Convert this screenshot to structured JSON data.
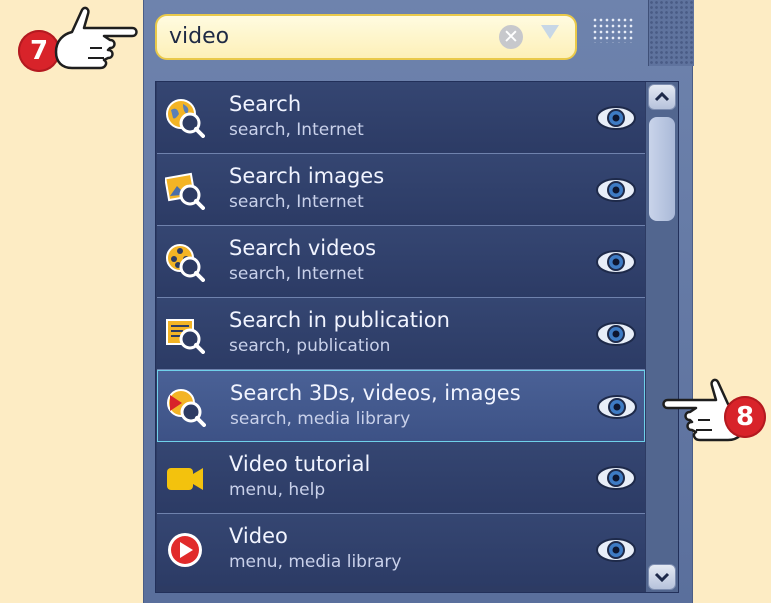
{
  "search": {
    "value": "video"
  },
  "callouts": [
    "7",
    "8"
  ],
  "results": [
    {
      "title": "Search",
      "tags": "search, Internet",
      "icon": "globe-search-icon"
    },
    {
      "title": "Search images",
      "tags": "search, Internet",
      "icon": "image-search-icon"
    },
    {
      "title": "Search videos",
      "tags": "search, Internet",
      "icon": "film-reel-search-icon"
    },
    {
      "title": "Search in publication",
      "tags": "search, publication",
      "icon": "publication-search-icon"
    },
    {
      "title": "Search 3Ds, videos, images",
      "tags": "search, media library",
      "icon": "media-search-icon"
    },
    {
      "title": "Video tutorial",
      "tags": "menu, help",
      "icon": "video-camera-icon"
    },
    {
      "title": "Video",
      "tags": "menu, media library",
      "icon": "play-circle-icon"
    }
  ],
  "colors": {
    "background": "#fdecc4",
    "panel": "#5a6f9c",
    "list_bg": "#2d3b63",
    "selected_border": "#6fd1ea",
    "badge": "#d8232a",
    "search_field": "#fdf0b8"
  }
}
